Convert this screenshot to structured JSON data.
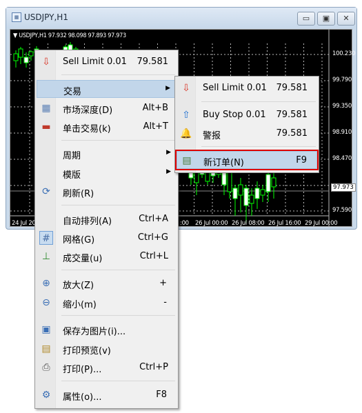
{
  "window": {
    "title": "USDJPY,H1",
    "controls": {
      "minimize": "▭",
      "maximize": "▣",
      "close": "✕"
    }
  },
  "chart": {
    "header": "▼ USDJPY,H1  97.932 98.098 97.893 97.973",
    "price_labels": [
      "100.230",
      "99.790",
      "99.350",
      "98.910",
      "98.470",
      "97.590"
    ],
    "current_price": "97.973",
    "time_labels": [
      "24 Jul 201",
      ":00",
      "26 Jul 00:00",
      "26 Jul 08:00",
      "26 Jul 16:00",
      "29 Jul 00:00"
    ],
    "colors": {
      "background": "#000000",
      "candle": "#00ff00",
      "grid": "#c0c0c0"
    }
  },
  "context_menu": {
    "items": [
      {
        "label": "Sell Limit 0.01",
        "shortcut": "79.581",
        "icon": "sell-limit-icon"
      },
      {
        "label": "交易",
        "submenu": true
      },
      {
        "label": "市场深度(D)",
        "shortcut": "Alt+B",
        "icon": "market-depth-icon"
      },
      {
        "label": "单击交易(k)",
        "shortcut": "Alt+T",
        "icon": "one-click-trading-icon"
      },
      {
        "label": "周期",
        "submenu": true
      },
      {
        "label": "模版",
        "submenu": true
      },
      {
        "label": "刷新(R)",
        "icon": "refresh-icon"
      },
      {
        "label": "自动排列(A)",
        "shortcut": "Ctrl+A"
      },
      {
        "label": "网格(G)",
        "shortcut": "Ctrl+G",
        "icon": "grid-icon",
        "checked": true
      },
      {
        "label": "成交量(u)",
        "shortcut": "Ctrl+L",
        "icon": "volume-icon"
      },
      {
        "label": "放大(Z)",
        "shortcut": "+",
        "icon": "zoom-in-icon"
      },
      {
        "label": "缩小(m)",
        "shortcut": "-",
        "icon": "zoom-out-icon"
      },
      {
        "label": "保存为图片(i)...",
        "icon": "save-picture-icon"
      },
      {
        "label": "打印预览(v)",
        "icon": "print-preview-icon"
      },
      {
        "label": "打印(P)...",
        "shortcut": "Ctrl+P",
        "icon": "print-icon"
      },
      {
        "label": "属性(o)...",
        "shortcut": "F8",
        "icon": "properties-icon"
      }
    ]
  },
  "trade_submenu": {
    "items": [
      {
        "label": "Sell Limit 0.01",
        "value": "79.581",
        "icon": "sell-limit-icon"
      },
      {
        "label": "Buy Stop 0.01",
        "value": "79.581",
        "icon": "buy-stop-icon"
      },
      {
        "label": "警报",
        "value": "79.581",
        "icon": "alert-bell-icon"
      },
      {
        "label": "新订单(N)",
        "value": "F9",
        "icon": "new-order-icon",
        "highlighted": true
      }
    ]
  }
}
